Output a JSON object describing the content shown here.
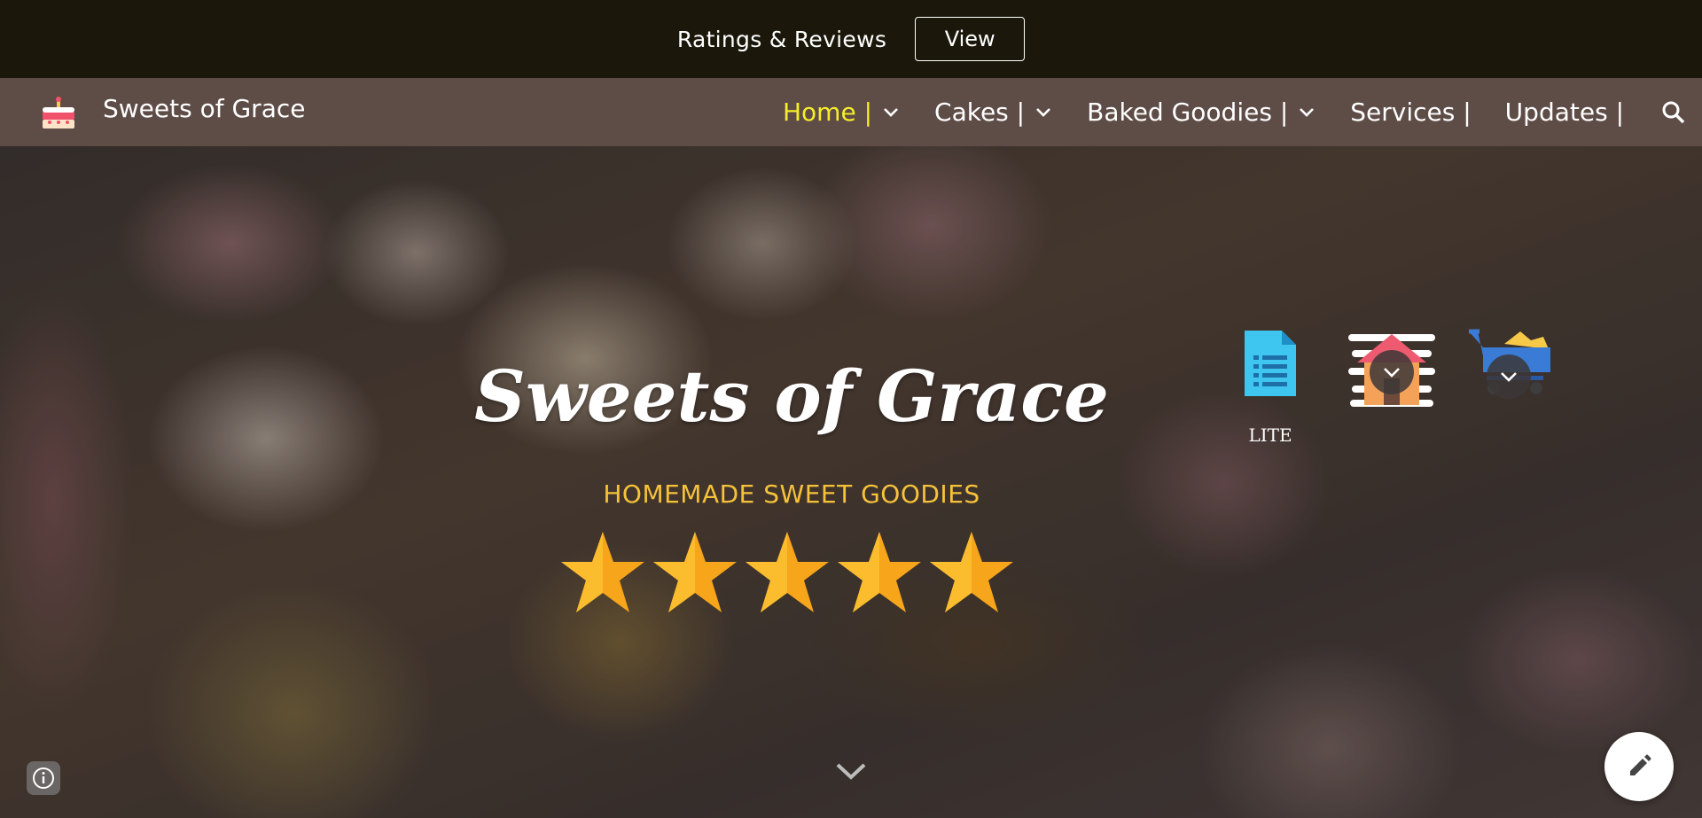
{
  "announcement": {
    "text": "Ratings & Reviews",
    "button_label": "View"
  },
  "header": {
    "site_title": "Sweets of Grace",
    "logo_icon": "cake-icon",
    "nav": [
      {
        "label": "Home |",
        "active": true,
        "has_dropdown": true
      },
      {
        "label": "Cakes |",
        "active": false,
        "has_dropdown": true
      },
      {
        "label": "Baked Goodies |",
        "active": false,
        "has_dropdown": true
      },
      {
        "label": "Services |",
        "active": false,
        "has_dropdown": false
      },
      {
        "label": "Updates |",
        "active": false,
        "has_dropdown": false
      }
    ],
    "search_icon": "search-icon"
  },
  "hero": {
    "title": "Sweets of Grace",
    "subtitle": "HOMEMADE SWEET GOODIES",
    "rating": 5,
    "rating_max": 5,
    "quick_links": [
      {
        "icon": "document-icon",
        "label": "LITE"
      },
      {
        "icon": "house-icon",
        "label": ""
      },
      {
        "icon": "shopping-cart-icon",
        "label": ""
      }
    ]
  },
  "colors": {
    "announce_bg": "#1b180b",
    "header_bg": "#5e4c47",
    "nav_active": "#f6ee2b",
    "subtitle": "#f5c23a",
    "star": "#f7a51a"
  }
}
